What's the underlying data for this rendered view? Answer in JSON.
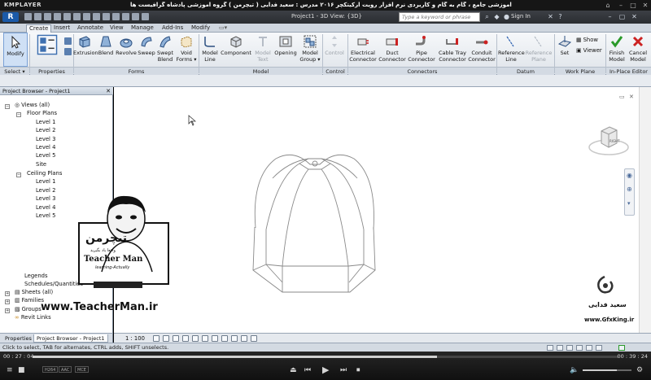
{
  "player": {
    "logo": "KMPLAYER",
    "caption": "مجموعه آموزشی جامع ، گام به گام و کاربردی نرم افزار رویت آرکیتکچر ۲۰۱۶   مدرس : سعید فدایی ( تیچرمن ) گروه آموزشی پادشاه گرافیست ها",
    "time_current": "00 : 27 : 04",
    "time_total": "00 : 39 : 24",
    "progress_fraction": 0.69,
    "tags": [
      "H264",
      "AAC",
      "MCE"
    ]
  },
  "app": {
    "doc_title": "Project1 - 3D View: {3D}",
    "search_placeholder": "Type a keyword or phrase",
    "sign_in": "Sign In"
  },
  "ribbon": {
    "tabs": [
      "Create",
      "Insert",
      "Annotate",
      "View",
      "Manage",
      "Add-Ins",
      "Modify"
    ],
    "active_tab": "Create",
    "buttons": {
      "modify": "Modify",
      "extrusion": "Extrusion",
      "blend": "Blend",
      "revolve": "Revolve",
      "sweep": "Sweep",
      "swept_blend": "Swept Blend",
      "void_forms": "Void Forms",
      "model_line": "Model Line",
      "component": "Component",
      "model_text": "Model Text",
      "opening": "Opening",
      "model_group": "Model Group",
      "control": "Control",
      "electrical_connector": "Electrical Connector",
      "duct_connector": "Duct Connector",
      "pipe_connector": "Pipe Connector",
      "cable_tray_connector": "Cable Tray Connector",
      "conduit_connector": "Conduit Connector",
      "reference_line": "Reference Line",
      "reference_plane": "Reference Plane",
      "set": "Set",
      "show": "Show",
      "viewer": "Viewer",
      "finish_model": "Finish Model",
      "cancel_model": "Cancel Model"
    },
    "panels": {
      "select": "Select",
      "properties": "Properties",
      "forms": "Forms",
      "model": "Model",
      "control": "Control",
      "connectors": "Connectors",
      "datum": "Datum",
      "work_plane": "Work Plane",
      "in_place_editor": "In-Place Editor"
    }
  },
  "project_browser": {
    "title": "Project Browser - Project1",
    "items": {
      "views_all": "Views (all)",
      "floor_plans": "Floor Plans",
      "fp_level1": "Level 1",
      "fp_level2": "Level 2",
      "fp_level3": "Level 3",
      "fp_level4": "Level 4",
      "fp_level5": "Level 5",
      "fp_site": "Site",
      "ceiling_plans": "Ceiling Plans",
      "cp_level1": "Level 1",
      "cp_level2": "Level 2",
      "cp_level3": "Level 3",
      "cp_level4": "Level 4",
      "cp_level5": "Level 5",
      "legends": "Legends",
      "schedules": "Schedules/Quantities",
      "sheets": "Sheets (all)",
      "families": "Families",
      "groups": "Groups",
      "revit_links": "Revit Links"
    },
    "tabs": [
      "Properties",
      "Project Browser - Project1"
    ]
  },
  "view": {
    "scale": "1 : 100",
    "viewcube_face": "RIGHT"
  },
  "status_bar": {
    "message": "Click to select, TAB for alternates, CTRL adds, SHIFT unselects."
  },
  "watermarks": {
    "teacherman_logo": "تیچرمن",
    "teacherman_tagline": "واقعا یاد بگیرید",
    "teacherman_name": "Teacher Man",
    "teacherman_sub": "learning-Actually",
    "teacherman_url": "www.TeacherMan.ir",
    "gfxking_name": "سعید فدایی",
    "gfxking_url": "www.GfxKing.ir"
  },
  "colors": {
    "ribbon_bg": "#e8ecf1",
    "panel_title_bg": "#d3dae3",
    "app_bar": "#2f3237",
    "accent_blue": "#1b5aa8"
  }
}
